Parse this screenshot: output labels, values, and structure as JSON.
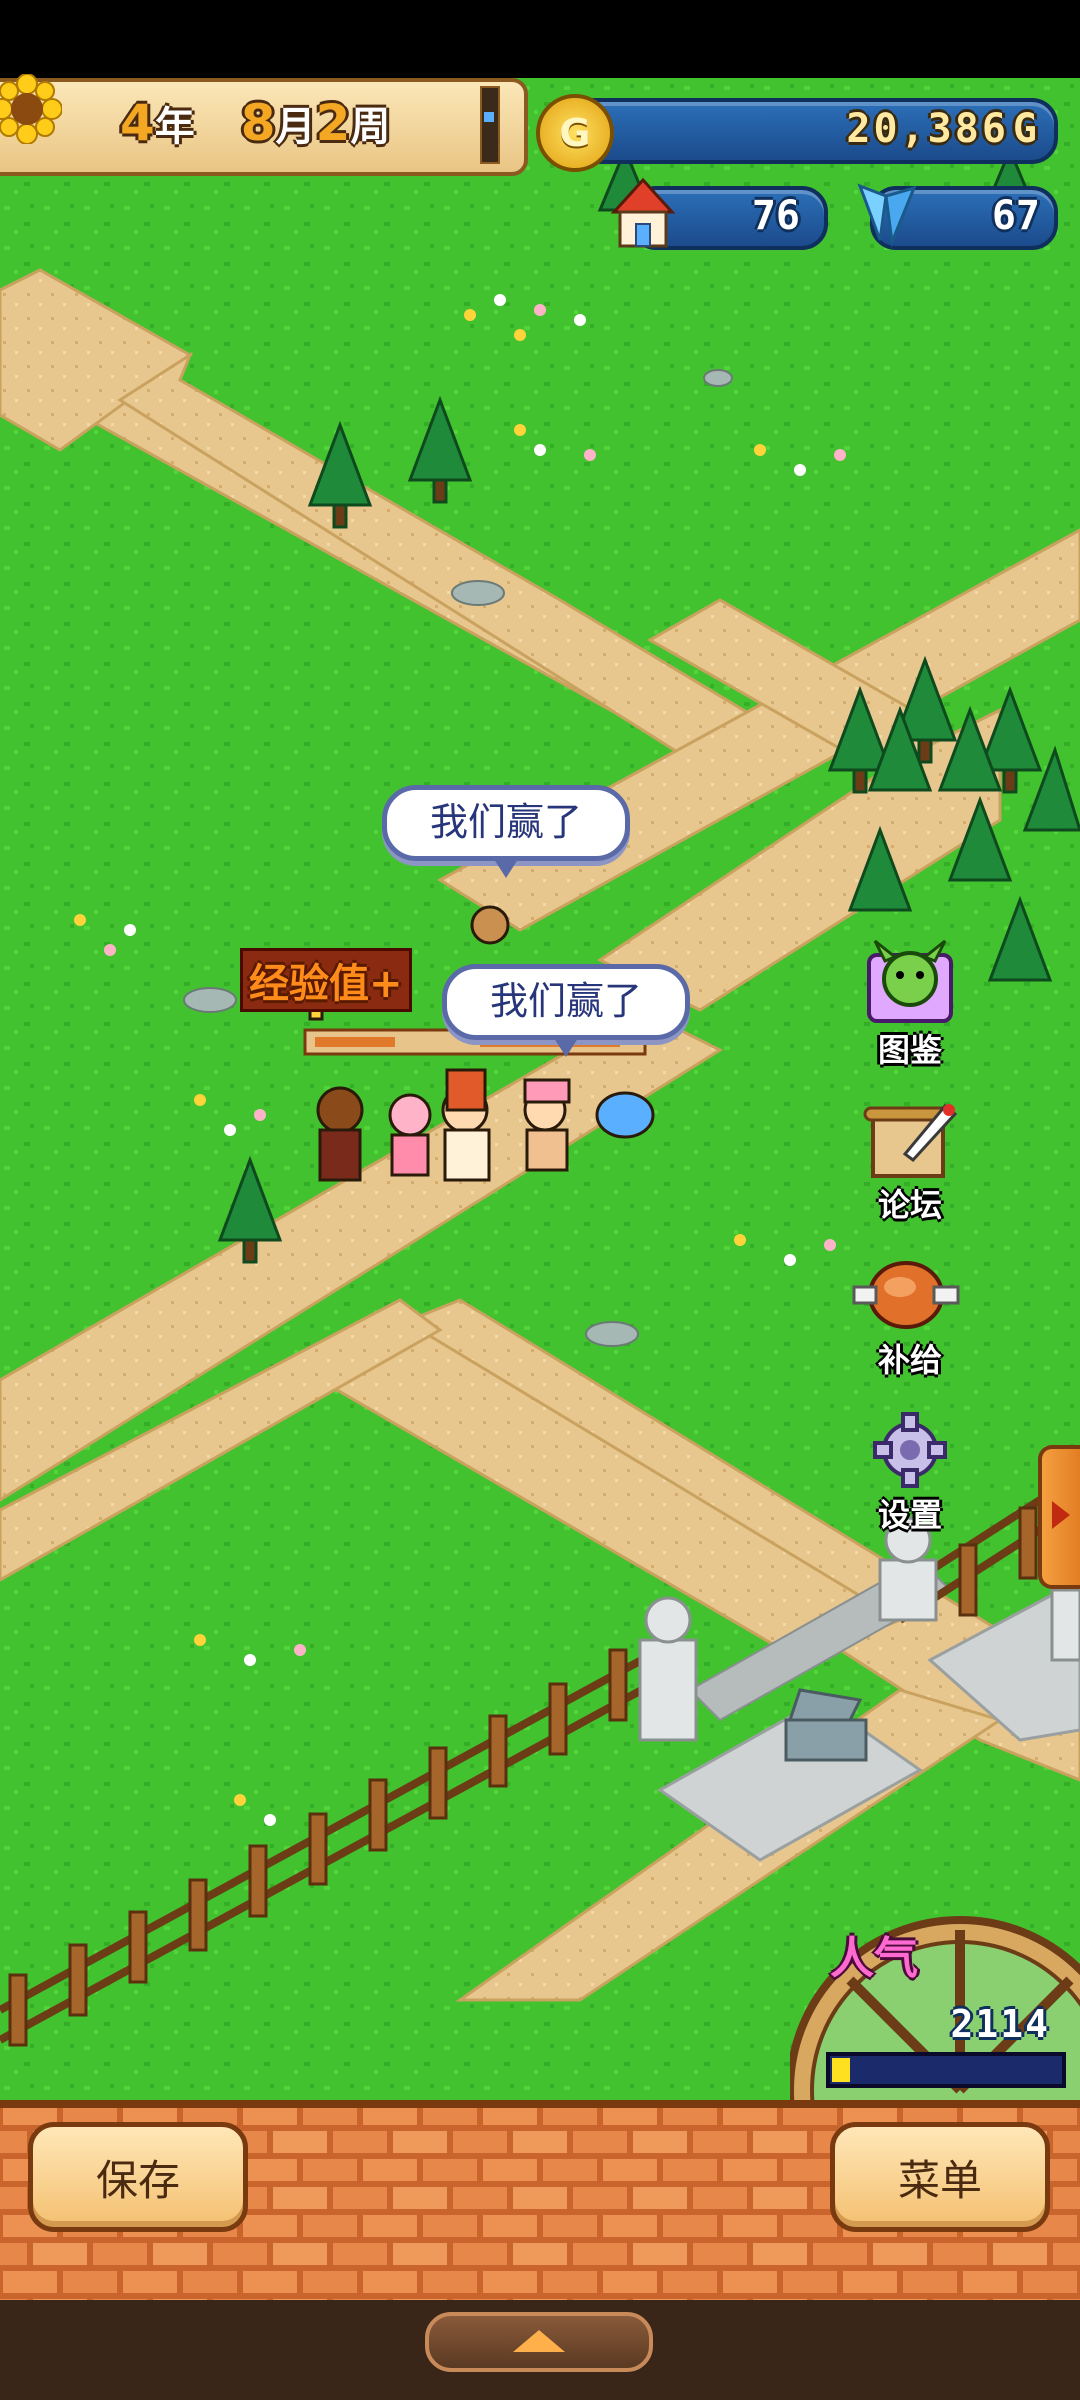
{
  "hud": {
    "year_num": "4",
    "year_unit": "年",
    "month_num": "8",
    "month_unit": "月",
    "week_num": "2",
    "week_unit": "周",
    "gold": "20,386",
    "gold_unit": "G",
    "coin_symbol": "G",
    "houses": "76",
    "crystals": "67"
  },
  "bubbles": [
    "我们赢了",
    "我们赢了"
  ],
  "floating_text": [
    "经验值+"
  ],
  "side_menu": [
    {
      "label": "图鉴",
      "icon": "dragon-encyclopedia-icon"
    },
    {
      "label": "论坛",
      "icon": "scroll-quill-icon"
    },
    {
      "label": "补给",
      "icon": "meat-icon"
    },
    {
      "label": "设置",
      "icon": "gear-icon"
    }
  ],
  "popularity": {
    "label": "人气",
    "value": "2114",
    "fill": 0.08
  },
  "bottom": {
    "save": "保存",
    "menu": "菜单"
  },
  "colors": {
    "grass": "#3fbf2c",
    "path": "#e6c48a",
    "brick": "#e7874a",
    "hud_blue": "#2c6fb8"
  }
}
